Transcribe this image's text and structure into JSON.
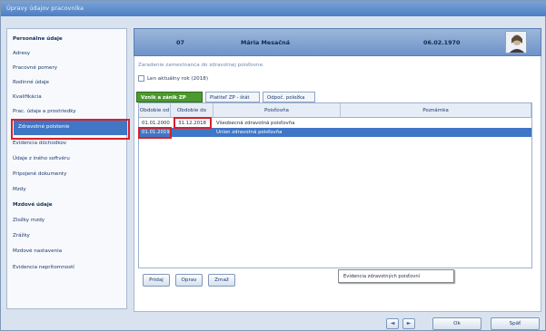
{
  "window": {
    "title": "Úpravy údajov pracovníka"
  },
  "sidebar": {
    "items": [
      {
        "label": "Personálne údaje",
        "type": "header"
      },
      {
        "label": "Adresy"
      },
      {
        "label": "Pracovné pomery"
      },
      {
        "label": "Rodinné údaje"
      },
      {
        "label": "Kvalifikácia"
      },
      {
        "label": "Prac. údaje a prostriedky"
      },
      {
        "label": "Zdravotné poistenie",
        "active": true
      },
      {
        "label": "Evidencia dôchodkov"
      },
      {
        "label": "Údaje z iného softvéru"
      },
      {
        "label": "Pripojené dokumenty"
      },
      {
        "label": "Mzdy"
      },
      {
        "label": "Mzdové údaje",
        "type": "header"
      },
      {
        "label": "Zložky mzdy"
      },
      {
        "label": "Zrážky"
      },
      {
        "label": "Mzdové nastavenia"
      },
      {
        "label": "Evidencia neprítomností"
      }
    ]
  },
  "header": {
    "code": "07",
    "name": "Mária Mesačná",
    "date": "06.02.1970"
  },
  "content": {
    "note": "Zaradenie zamestnanca do zdravotnej poisťovne.",
    "checkbox_label": "Len aktuálny rok (2018)",
    "tabs": [
      {
        "label": "Vznik a zánik ZP",
        "active": true
      },
      {
        "label": "Platiteľ ZP - štát"
      },
      {
        "label": "Odpoč. položka"
      }
    ],
    "grid": {
      "columns": [
        "Obdobie od",
        "Obdobie do",
        "Poisťovňa",
        "Poznámka"
      ],
      "rows": [
        {
          "from": "01.01.2000",
          "to": "31.12.2018",
          "insurer": "Všeobecná zdravotná poisťovňa",
          "note": ""
        },
        {
          "from": "01.01.2019",
          "to": "",
          "insurer": "Union zdravotná poisťovňa",
          "note": "",
          "selected": true
        }
      ]
    },
    "tooltip": "Evidencia zdravotných poisťovní",
    "buttons": {
      "add": "Pridaj",
      "edit": "Oprav",
      "delete": "Zmaž"
    }
  },
  "footer": {
    "prev": "◄",
    "next": "►",
    "ok": "Ok",
    "cancel": "Späť"
  },
  "colors": {
    "accent": "#3f76c6",
    "highlight": "#d8202a",
    "tab_active": "#4c9a2f"
  }
}
